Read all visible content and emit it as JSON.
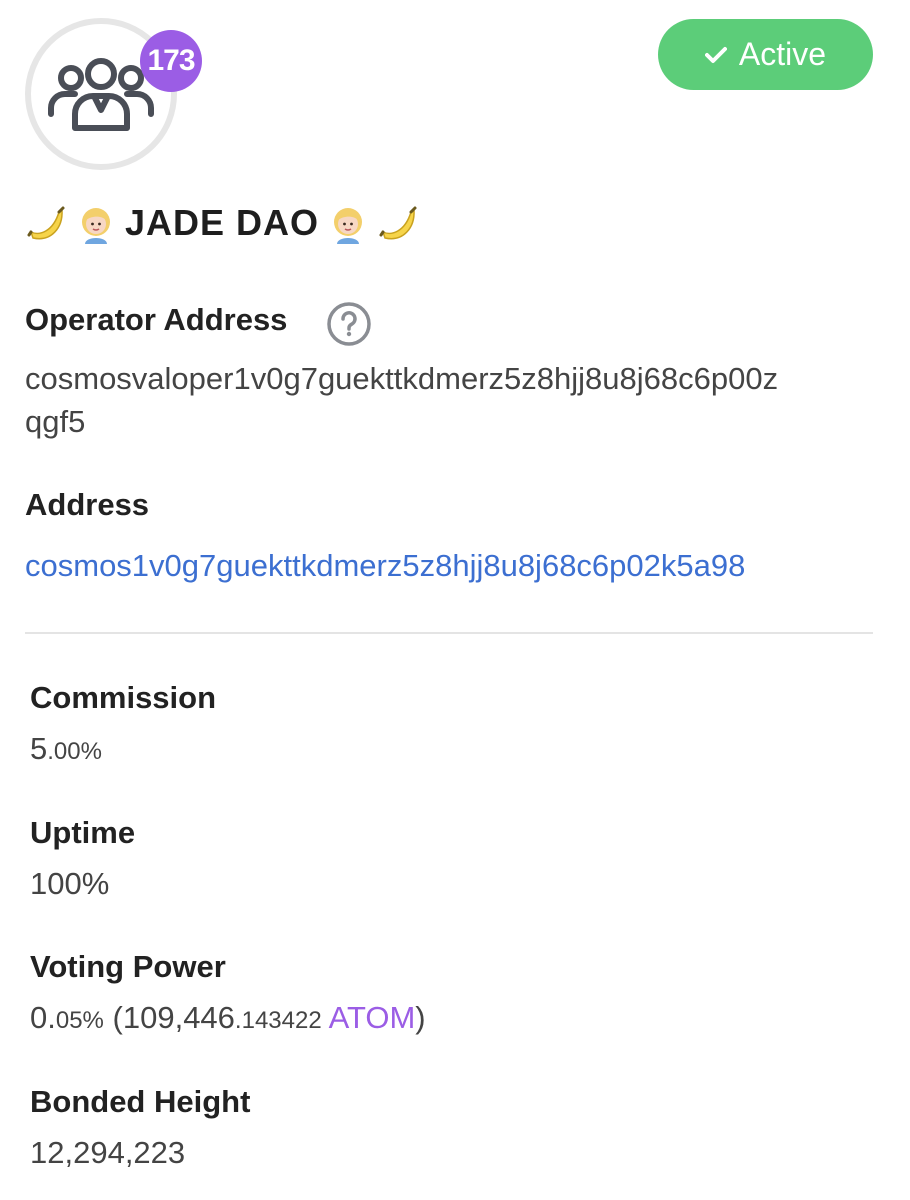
{
  "validator": {
    "name": "JADE DAO",
    "delegator_count": "173",
    "status": "Active",
    "icons": [
      "users-icon",
      "banana-emoji",
      "woman-emoji",
      "check-icon",
      "question-icon"
    ]
  },
  "operator_address": {
    "label": "Operator Address",
    "line1": "cosmosvaloper1v0g7guekttkdmerz5z8hjj8u8j68c6p00z",
    "line2": "qgf5"
  },
  "address": {
    "label": "Address",
    "value": "cosmos1v0g7guekttkdmerz5z8hjj8u8j68c6p02k5a98"
  },
  "commission": {
    "label": "Commission",
    "int": "5",
    "dec": ".00%"
  },
  "uptime": {
    "label": "Uptime",
    "value": "100%"
  },
  "voting_power": {
    "label": "Voting Power",
    "pct_int": "0.",
    "pct_dec": "05%",
    "amount_int": "(109,446",
    "amount_dec": ".143422",
    "denom": "ATOM",
    "close": ")"
  },
  "bonded_height": {
    "label": "Bonded Height",
    "value": "12,294,223"
  },
  "colors": {
    "status_green": "#5ccd79",
    "badge_purple": "#9b5de5",
    "link_blue": "#3c6fd1"
  }
}
